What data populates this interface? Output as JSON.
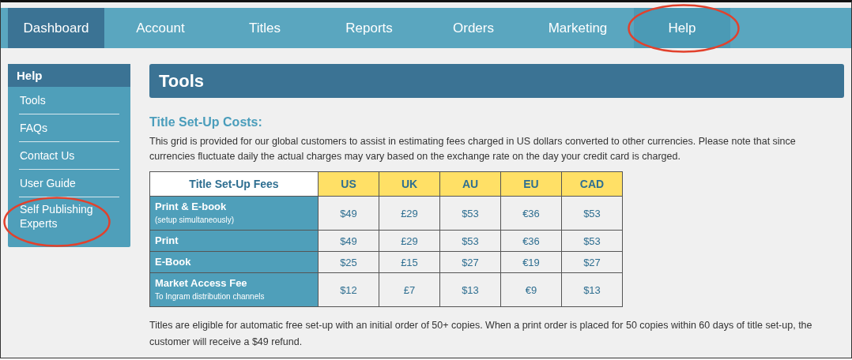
{
  "nav": [
    {
      "label": "Dashboard",
      "selected": true,
      "hovered": false,
      "circled": false
    },
    {
      "label": "Account",
      "selected": false,
      "hovered": false,
      "circled": false
    },
    {
      "label": "Titles",
      "selected": false,
      "hovered": false,
      "circled": false
    },
    {
      "label": "Reports",
      "selected": false,
      "hovered": false,
      "circled": false
    },
    {
      "label": "Orders",
      "selected": false,
      "hovered": false,
      "circled": false
    },
    {
      "label": "Marketing",
      "selected": false,
      "hovered": false,
      "circled": false
    },
    {
      "label": "Help",
      "selected": false,
      "hovered": true,
      "circled": true
    }
  ],
  "sidebar": {
    "title": "Help",
    "items": [
      {
        "label": "Tools",
        "circled": false
      },
      {
        "label": "FAQs",
        "circled": false
      },
      {
        "label": "Contact Us",
        "circled": false
      },
      {
        "label": "User Guide",
        "circled": false
      },
      {
        "label": "Self Publishing Experts",
        "circled": true
      }
    ]
  },
  "page_title": "Tools",
  "section_title": "Title Set-Up Costs:",
  "intro": "This grid is provided for our global customers to assist in estimating fees charged in US dollars converted to other currencies. Please note that since currencies fluctuate daily the actual charges may vary based on the exchange rate on the day your credit card is charged.",
  "table": {
    "columns": [
      "Title Set-Up Fees",
      "US",
      "UK",
      "AU",
      "EU",
      "CAD"
    ],
    "rows": [
      {
        "label": "Print & E-book",
        "note": "(setup simultaneously)",
        "values": [
          "$49",
          "£29",
          "$53",
          "€36",
          "$53"
        ]
      },
      {
        "label": "Print",
        "values": [
          "$49",
          "£29",
          "$53",
          "€36",
          "$53"
        ]
      },
      {
        "label": "E-Book",
        "values": [
          "$25",
          "£15",
          "$27",
          "€19",
          "$27"
        ]
      },
      {
        "label": "Market Access Fee",
        "note": "To Ingram distribution channels",
        "values": [
          "$12",
          "£7",
          "$13",
          "€9",
          "$13"
        ]
      }
    ]
  },
  "footer": "Titles are eligible for automatic free set-up with an initial order of 50+ copies. When a print order is placed for 50 copies within 60 days of title set-up, the customer will receive a $49 refund."
}
